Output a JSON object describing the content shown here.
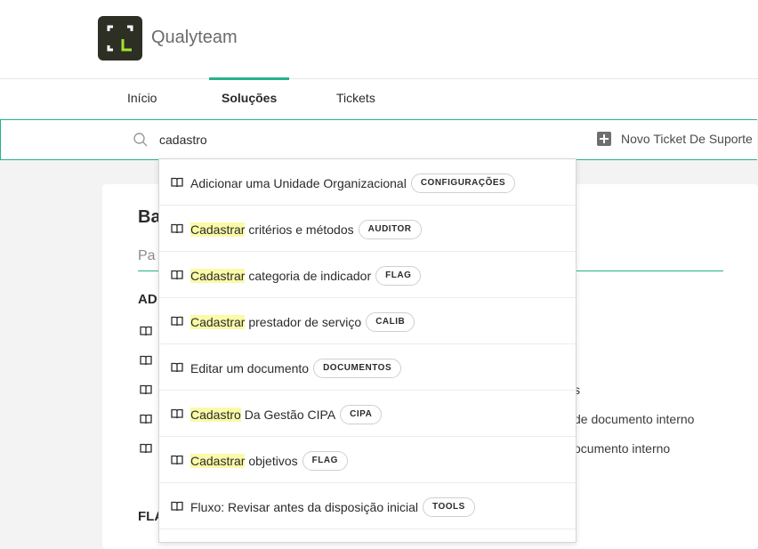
{
  "header": {
    "brand": "Qualyteam"
  },
  "nav": {
    "tabs": [
      "Início",
      "Soluções",
      "Tickets"
    ],
    "active": "Soluções"
  },
  "search": {
    "value": "cadastro",
    "placeholder": ""
  },
  "new_ticket_label": "Novo Ticket De Suporte",
  "background_card": {
    "title": "Ba",
    "subtitle": "Pa",
    "section_1": "AD",
    "section_2": "FLA",
    "partial_texts": [
      "s",
      "de documento interno",
      "ocumento interno"
    ]
  },
  "results": [
    {
      "pre": "",
      "hl": "",
      "post": "Adicionar uma Unidade Organizacional",
      "badge": "CONFIGURAÇÕES"
    },
    {
      "pre": "",
      "hl": "Cadastrar",
      "post": " critérios e métodos",
      "badge": "AUDITOR"
    },
    {
      "pre": "",
      "hl": "Cadastrar",
      "post": " categoria de indicador",
      "badge": "FLAG"
    },
    {
      "pre": "",
      "hl": "Cadastrar",
      "post": " prestador de serviço",
      "badge": "CALIB"
    },
    {
      "pre": "",
      "hl": "",
      "post": "Editar um documento",
      "badge": "DOCUMENTOS"
    },
    {
      "pre": "",
      "hl": "Cadastro",
      "post": " Da Gestão CIPA",
      "badge": "CIPA"
    },
    {
      "pre": "",
      "hl": "Cadastrar",
      "post": " objetivos",
      "badge": "FLAG"
    },
    {
      "pre": "",
      "hl": "",
      "post": "Fluxo: Revisar antes da disposição inicial",
      "badge": "TOOLS"
    }
  ],
  "colors": {
    "accent": "#27b18a",
    "highlight": "#fafaa8",
    "logo_bg": "#2d2f25",
    "logo_accent": "#a6e22e"
  }
}
